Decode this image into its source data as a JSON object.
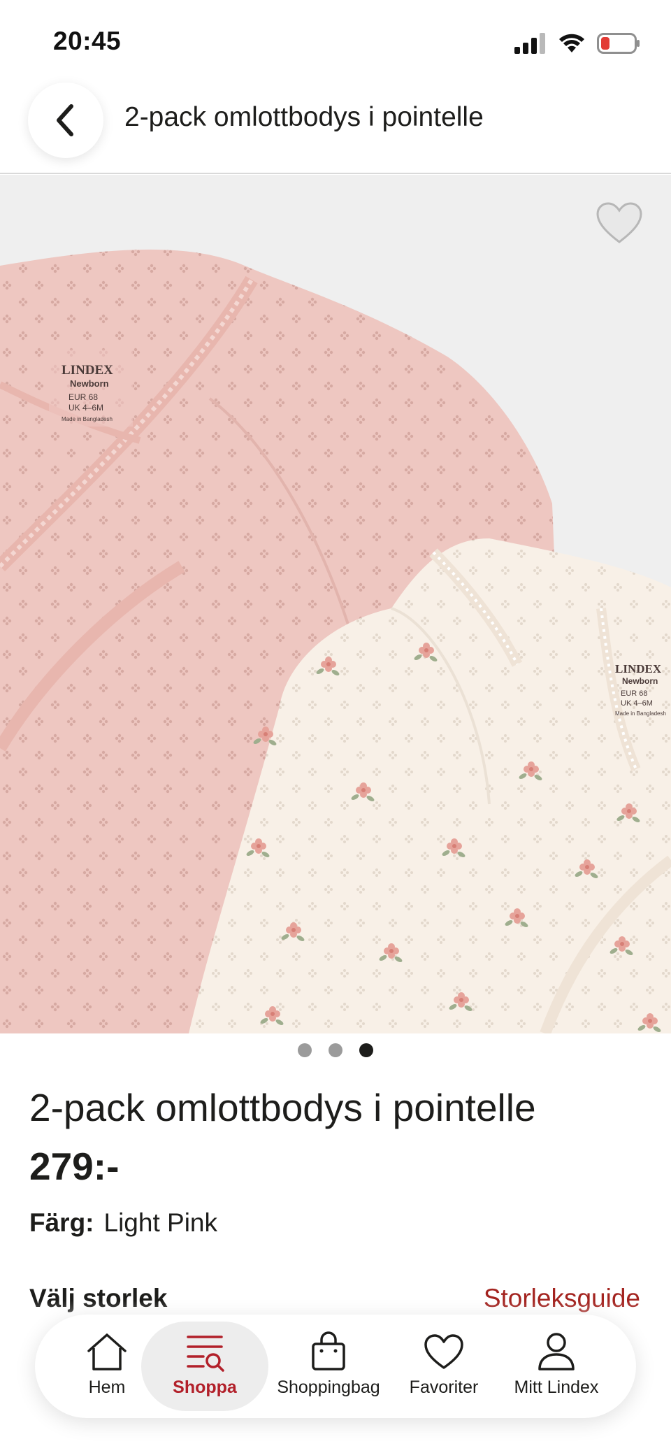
{
  "status_bar": {
    "time": "20:45"
  },
  "header": {
    "title": "2-pack  omlottbodys i pointelle"
  },
  "gallery": {
    "label_left": {
      "brand": "LINDEX",
      "line": "Newborn",
      "eur": "EUR  68",
      "uk": "UK   4–6M",
      "made": "Made in Bangladesh"
    },
    "label_right": {
      "brand": "LINDEX",
      "line": "Newborn",
      "eur": "EUR  68",
      "uk": "UK   4–6M",
      "made": "Made in Bangladesh"
    },
    "slide_count": 3,
    "active_slide": 3
  },
  "product": {
    "title": "2-pack  omlottbodys i pointelle",
    "price": "279:-",
    "color_label": "Färg:",
    "color_value": "Light Pink",
    "size_label": "Välj storlek",
    "size_guide": "Storleksguide"
  },
  "nav": {
    "items": [
      {
        "label": "Hem",
        "icon": "home-icon"
      },
      {
        "label": "Shoppa",
        "icon": "shop-search-icon"
      },
      {
        "label": "Shoppingbag",
        "icon": "shopping-bag-icon"
      },
      {
        "label": "Favoriter",
        "icon": "heart-icon"
      },
      {
        "label": "Mitt Lindex",
        "icon": "user-icon"
      }
    ],
    "active_index": 1
  },
  "colors": {
    "accent": "#b2202a",
    "size_guide": "#a3231f",
    "pink_garment": "#edc6c0",
    "cream_garment": "#f8efe6"
  }
}
